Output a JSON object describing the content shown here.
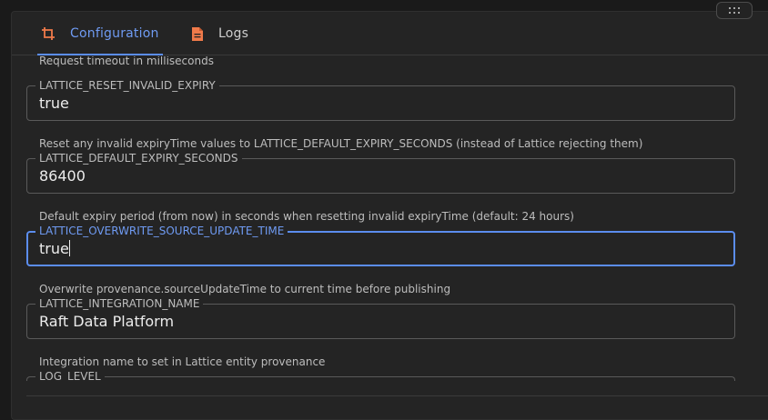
{
  "tabs": [
    {
      "label": "Configuration",
      "icon": "crop-icon",
      "active": true
    },
    {
      "label": "Logs",
      "icon": "document-icon",
      "active": false
    }
  ],
  "fields": {
    "timeout_helper": "Request timeout in milliseconds",
    "reset_invalid_expiry": {
      "label": "LATTICE_RESET_INVALID_EXPIRY",
      "value": "true",
      "helper": "Reset any invalid expiryTime values to LATTICE_DEFAULT_EXPIRY_SECONDS (instead of Lattice rejecting them)"
    },
    "default_expiry_seconds": {
      "label": "LATTICE_DEFAULT_EXPIRY_SECONDS",
      "value": "86400",
      "helper": "Default expiry period (from now) in seconds when resetting invalid expiryTime (default: 24 hours)"
    },
    "overwrite_source_update_time": {
      "label": "LATTICE_OVERWRITE_SOURCE_UPDATE_TIME",
      "value": "true",
      "helper": "Overwrite provenance.sourceUpdateTime to current time before publishing"
    },
    "integration_name": {
      "label": "LATTICE_INTEGRATION_NAME",
      "value": "Raft Data Platform",
      "helper": "Integration name to set in Lattice entity provenance"
    },
    "log_level": {
      "label": "LOG_LEVEL"
    }
  },
  "colors": {
    "accent": "#5b8def",
    "tab_icon": "#f07a4a",
    "panel_bg": "#242424",
    "page_bg": "#1a1a1a"
  }
}
